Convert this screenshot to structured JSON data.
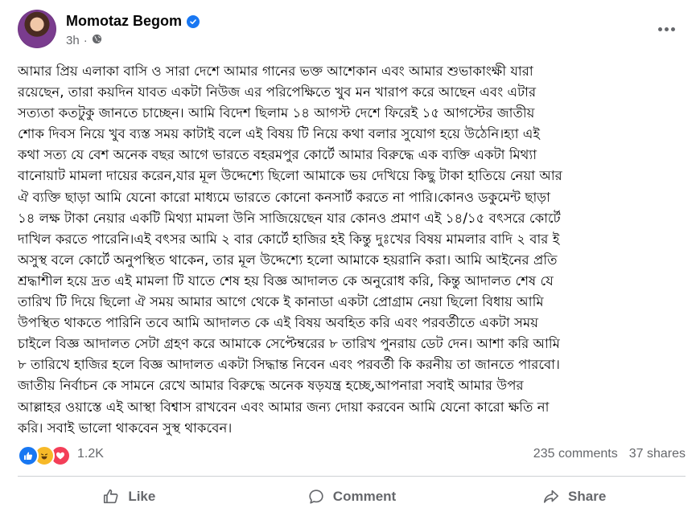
{
  "post": {
    "author_name": "Momotaz Begom",
    "time_ago": "3h",
    "separator": "·",
    "body_lines": [
      "আমার প্রিয় এলাকা বাসি ও সারা দেশে আমার গানের ভক্ত আশেকান এবং আমার শুভাকাংক্ষী যারা",
      "রয়েছেন, তারা কয়দিন যাবত একটা নিউজ এর পরিপেক্ষিতে খুব মন খারাপ করে আছেন এবং এটার",
      "সত্যতা কতটুকু জানতে চাচ্ছেন। আমি বিদেশ ছিলাম ১৪ আগস্ট দেশে ফিরেই ১৫ আগস্টের জাতীয়",
      "শোক দিবস নিয়ে খুব ব্যস্ত সময় কাটাই বলে এই বিষয় টি নিয়ে কথা বলার সুযোগ হয়ে উঠেনি।হ্যা এই",
      "কথা সত্য যে বেশ অনেক বছর আগে ভারতে বহরমপুর কোর্টে আমার বিরুদ্ধে এক ব্যক্তি একটা মিথ্যা",
      "বানোয়াট মামলা দায়ের করেন,যার মূল উদ্দেশ্যে ছিলো আমাকে ভয় দেখিয়ে কিছু টাকা হাতিয়ে নেয়া আর",
      "ঐ ব্যক্তি ছাড়া আমি যেনো কারো মাধ্যমে ভারতে কোনো কনসার্ট করতে না পারি।কোনও ডকুমেন্ট ছাড়া",
      "১৪ লক্ষ টাকা নেয়ার একটি মিথ্যা মামলা উনি সাজিয়েছেন যার কোনও প্রমাণ এই ১৪/১৫ বৎসরে কোর্টে",
      "দাখিল করতে পারেনি।এই বৎসর আমি ২ বার কোর্টে হাজির হই কিন্তু দুঃখের বিষয় মামলার বাদি ২ বার ই",
      "অসুস্থ বলে কোর্টে অনুপস্থিত থাকেন, তার মূল উদ্দেশ্যে হলো আমাকে হয়রানি করা। আমি আইনের প্রতি",
      "শ্রদ্ধাশীল হয়ে দ্রত এই মামলা টি যাতে শেষ হয় বিজ্ঞ আদালত কে অনুরোধ করি, কিন্তু আদালত শেষ যে",
      "তারিখ টি দিয়ে ছিলো ঐ সময় আমার আগে থেকে ই কানাডা একটা প্রোগ্রাম নেয়া ছিলো বিধায় আমি",
      "উপস্থিত থাকতে পারিনি তবে আমি আদালত কে এই বিষয় অবহিত করি এবং পরবর্তীতে একটা সময়",
      "চাইলে বিজ্ঞ আদালত সেটা গ্রহণ করে আমাকে সেপ্টেম্বরের ৮ তারিখ পুনরায় ডেট দেন। আশা করি আমি",
      "৮ তারিখে হাজির হলে বিজ্ঞ আদালত একটা সিদ্ধান্ত নিবেন এবং পরবর্তী কি করনীয় তা জানতে পারবো।",
      "জাতীয় নির্বাচন কে সামনে রেখে আমার বিরুদ্ধে অনেক ষড়যন্ত্র হচ্ছে,আপনারা সবাই আমার উপর",
      "আল্লাহর ওয়াস্তে এই আস্থা বিশ্বাস রাখবেন এবং আমার জন্য দোয়া করবেন আমি যেনো কারো ক্ষতি না",
      "করি। সবাই ভালো থাকবেন সুস্থ থাকবেন।"
    ],
    "reaction_count": "1.2K",
    "comments_count": "235 comments",
    "shares_count": "37 shares"
  },
  "actions": {
    "like": "Like",
    "comment": "Comment",
    "share": "Share"
  },
  "icons": {
    "audience": "globe-icon",
    "more": "more-options-icon",
    "reactions": [
      "like-reaction-icon",
      "haha-reaction-icon",
      "love-reaction-icon"
    ]
  },
  "colors": {
    "brand_blue": "#1877f2",
    "secondary_text": "#65676b",
    "like_reaction": "#1877f2",
    "haha_reaction": "#f7b928",
    "love_reaction": "#f33e58"
  }
}
